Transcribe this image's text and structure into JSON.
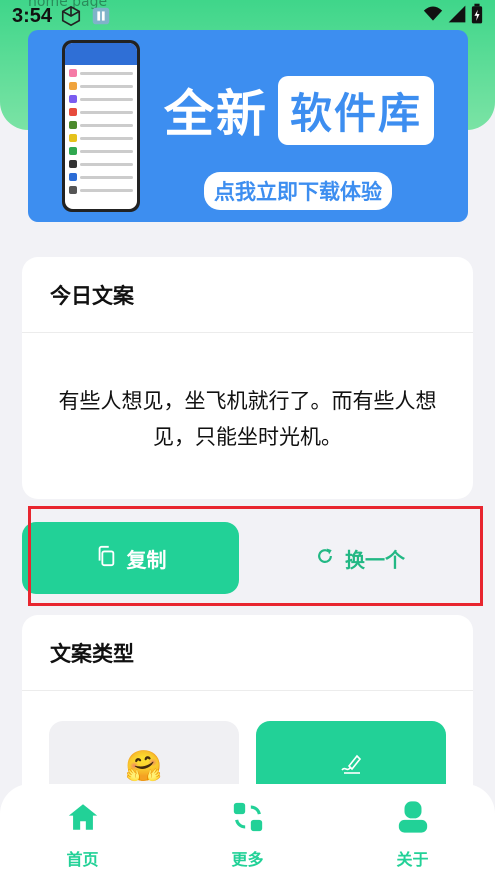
{
  "status_bar": {
    "time": "3:54",
    "ghost_text": "home page"
  },
  "banner": {
    "title_new": "全新",
    "title_lib": "软件库",
    "subtitle": "点我立即下载体验"
  },
  "today": {
    "title": "今日文案",
    "quote": "有些人想见，坐飞机就行了。而有些人想见，只能坐时光机。"
  },
  "actions": {
    "copy_label": "复制",
    "swap_label": "换一个"
  },
  "types": {
    "title": "文案类型",
    "tiles": [
      {
        "icon": "hugging-face-emoji",
        "glyph": "🤗"
      },
      {
        "icon": "writing-hand-icon",
        "glyph": "✍"
      }
    ]
  },
  "tabbar": {
    "items": [
      {
        "label": "首页",
        "icon": "home-icon"
      },
      {
        "label": "更多",
        "icon": "apps-swap-icon"
      },
      {
        "label": "关于",
        "icon": "user-icon"
      }
    ]
  },
  "colors": {
    "accent": "#22d197",
    "banner_blue": "#3d8ef0",
    "highlight_red": "#e8262f"
  }
}
